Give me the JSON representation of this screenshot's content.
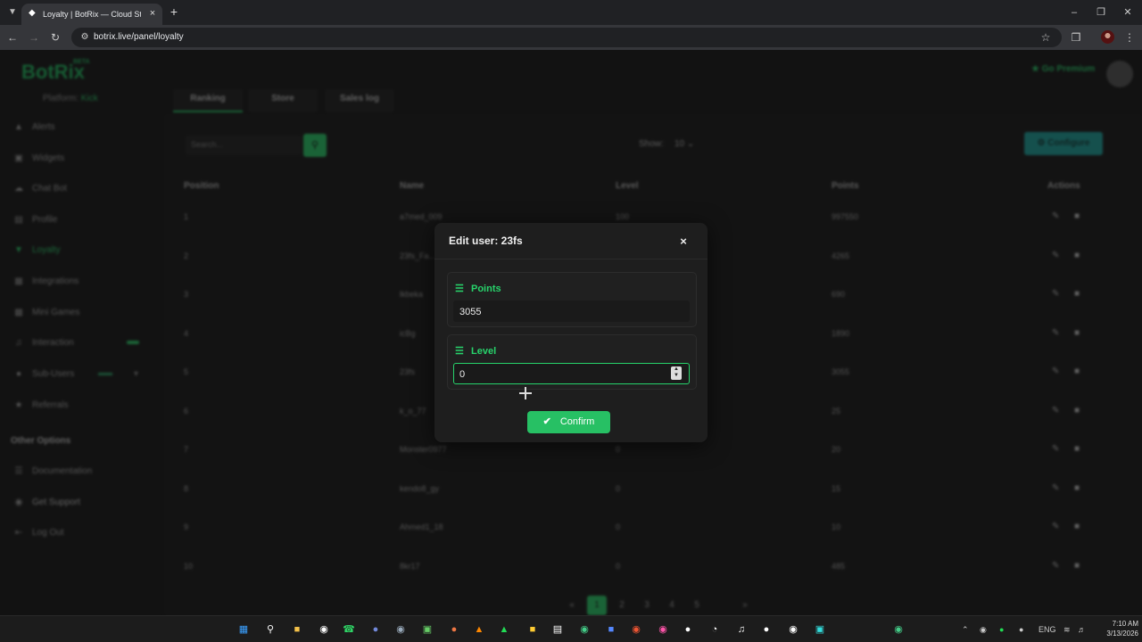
{
  "browser": {
    "tab_title": "Loyalty | BotRix — Cloud Strea…",
    "url": "botrix.live/panel/loyalty"
  },
  "sidebar": {
    "logo": "BotRix",
    "logo_badge": "BETA",
    "platform_label": "Platform:",
    "platform_value": "Kick",
    "items": [
      {
        "label": "Alerts",
        "icon": "warning-icon"
      },
      {
        "label": "Widgets",
        "icon": "widgets-icon"
      },
      {
        "label": "Chat Bot",
        "icon": "cloud-icon"
      },
      {
        "label": "Profile",
        "icon": "profile-icon"
      },
      {
        "label": "Loyalty",
        "icon": "trophy-icon"
      },
      {
        "label": "Integrations",
        "icon": "integrations-icon"
      },
      {
        "label": "Mini Games",
        "icon": "gamepad-icon"
      },
      {
        "label": "Interaction",
        "icon": "music-icon"
      },
      {
        "label": "Sub-Users",
        "icon": "users-icon"
      },
      {
        "label": "Referrals",
        "icon": "referrals-icon"
      }
    ],
    "other_heading": "Other Options",
    "other_items": [
      {
        "label": "Documentation",
        "icon": "book-icon"
      },
      {
        "label": "Get Support",
        "icon": "support-icon"
      },
      {
        "label": "Log Out",
        "icon": "logout-icon"
      }
    ]
  },
  "header": {
    "go_premium": "Go Premium"
  },
  "page_tabs": [
    "Ranking",
    "Store",
    "Sales log"
  ],
  "toolbar": {
    "search_placeholder": "Search...",
    "show_label": "Show:",
    "show_value": "10",
    "configure_label": "Configure"
  },
  "table": {
    "headers": [
      "Position",
      "Name",
      "Level",
      "Points",
      "Actions"
    ],
    "rows": [
      {
        "position": "1",
        "name": "a7med_009",
        "level": "100",
        "points": "997550"
      },
      {
        "position": "2",
        "name": "23fs_Fa…",
        "level": "",
        "points": "4265"
      },
      {
        "position": "3",
        "name": "lkbeka",
        "level": "",
        "points": "690"
      },
      {
        "position": "4",
        "name": "icBg",
        "level": "",
        "points": "1890"
      },
      {
        "position": "5",
        "name": "23fs",
        "level": "",
        "points": "3055"
      },
      {
        "position": "6",
        "name": "k_o_77",
        "level": "",
        "points": "25"
      },
      {
        "position": "7",
        "name": "Monster0977",
        "level": "0",
        "points": "20"
      },
      {
        "position": "8",
        "name": "kendo8_gy",
        "level": "0",
        "points": "15"
      },
      {
        "position": "9",
        "name": "Ahmed1_18",
        "level": "0",
        "points": "10"
      },
      {
        "position": "10",
        "name": "8kr17",
        "level": "0",
        "points": "485"
      }
    ]
  },
  "pagination": [
    "1",
    "2",
    "3",
    "4",
    "5"
  ],
  "modal": {
    "title": "Edit user: 23fs",
    "close": "×",
    "points_label": "Points",
    "points_value": "3055",
    "level_label": "Level",
    "level_value": "0",
    "confirm_label": "Confirm"
  },
  "taskbar": {
    "language": "ENG",
    "time": "7:10 AM",
    "date": "3/13/2026"
  },
  "colors": {
    "accent": "#27d36b",
    "modal_bg": "#1e1e1e",
    "page_bg": "#121212"
  }
}
